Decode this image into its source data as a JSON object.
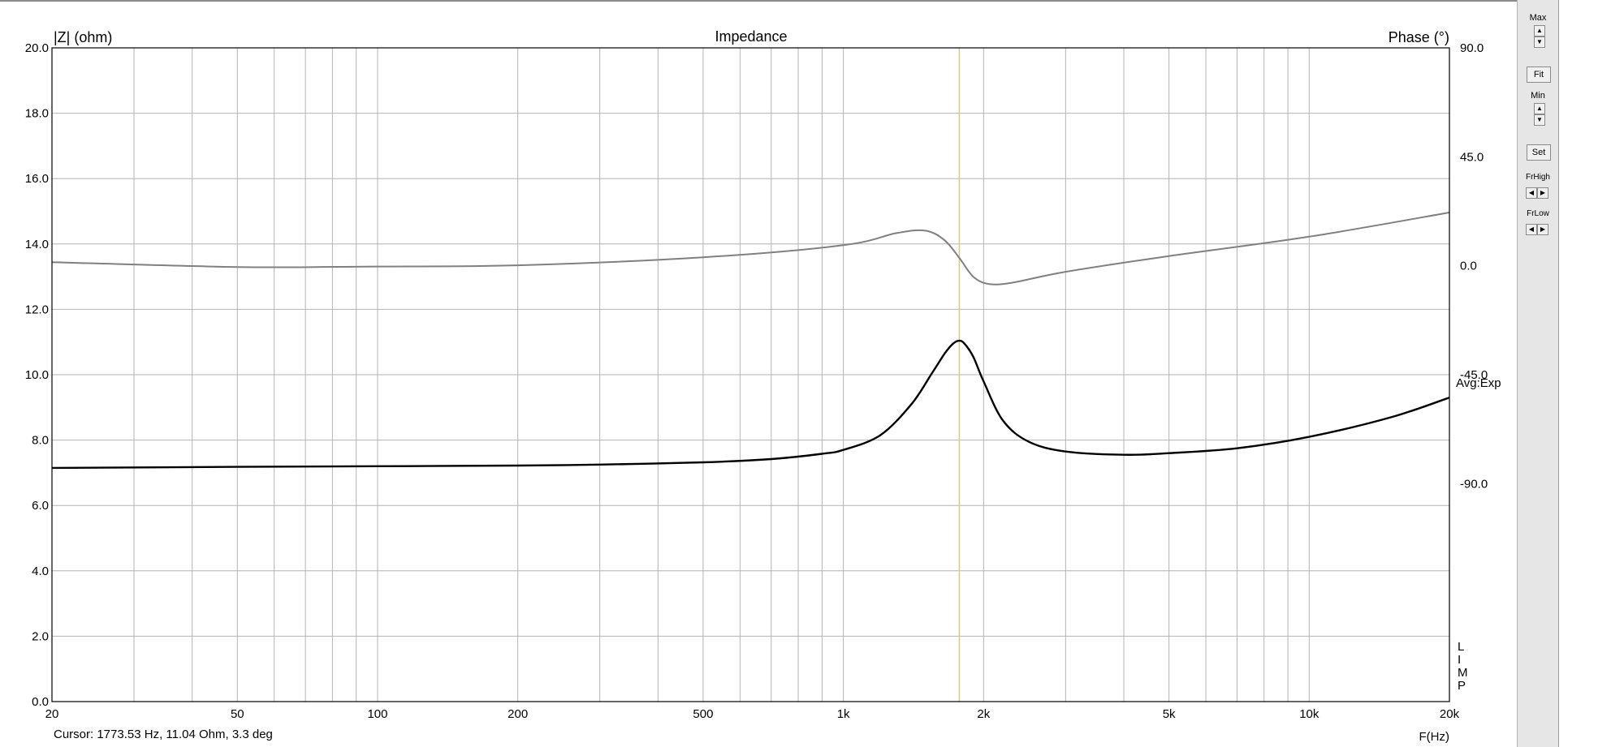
{
  "chart_data": {
    "type": "line",
    "title": "Impedance",
    "ylabel": "|Z| (ohm)",
    "y2label": "Phase (°)",
    "xlabel": "F(Hz)",
    "x_scale": "log",
    "xlim": [
      20,
      20000
    ],
    "ylim": [
      0,
      20
    ],
    "y2lim": [
      -180,
      90
    ],
    "x_ticks": [
      20,
      50,
      100,
      200,
      500,
      1000,
      2000,
      5000,
      10000,
      20000
    ],
    "x_tick_labels": [
      "20",
      "50",
      "100",
      "200",
      "500",
      "1k",
      "2k",
      "5k",
      "10k",
      "20k"
    ],
    "y_tick_labels": [
      "0.0",
      "2.0",
      "4.0",
      "6.0",
      "8.0",
      "10.0",
      "12.0",
      "14.0",
      "16.0",
      "18.0",
      "20.0"
    ],
    "y2_tick_labels": [
      "90.0",
      "45.0",
      "0.0",
      "-45.0",
      "-90.0"
    ],
    "grid": true,
    "cursor_freq": 1773.53,
    "series": [
      {
        "role": "magnitude",
        "color": "#000000",
        "x": [
          20,
          50,
          100,
          200,
          300,
          500,
          700,
          900,
          1000,
          1200,
          1400,
          1550,
          1650,
          1720,
          1773,
          1820,
          1900,
          2000,
          2200,
          2500,
          3000,
          4000,
          5000,
          7000,
          10000,
          15000,
          20000
        ],
        "y": [
          7.15,
          7.18,
          7.2,
          7.22,
          7.25,
          7.32,
          7.42,
          7.58,
          7.7,
          8.15,
          9.1,
          10.05,
          10.65,
          10.95,
          11.04,
          10.95,
          10.55,
          9.8,
          8.6,
          7.95,
          7.65,
          7.55,
          7.6,
          7.75,
          8.1,
          8.7,
          9.3
        ]
      },
      {
        "role": "phase",
        "color": "#808080",
        "x": [
          20,
          50,
          100,
          200,
          500,
          1000,
          1300,
          1500,
          1650,
          1773,
          1900,
          2050,
          2300,
          3000,
          5000,
          10000,
          20000
        ],
        "y": [
          1.5,
          -0.5,
          -0.3,
          0.2,
          3.5,
          8.5,
          13.5,
          14.5,
          10.5,
          3.3,
          -4.5,
          -7.5,
          -7,
          -2.5,
          4,
          12,
          22
        ]
      }
    ],
    "legend_text": "Avg:Exp",
    "side_letters": [
      "L",
      "I",
      "M",
      "P"
    ]
  },
  "status": {
    "cursor_readout": "Cursor: 1773.53 Hz, 11.04 Ohm, 3.3 deg"
  },
  "panel": {
    "max_label": "Max",
    "fit_label": "Fit",
    "min_label": "Min",
    "set_label": "Set",
    "frhigh_label": "FrHigh",
    "frlow_label": "FrLow"
  },
  "colors": {
    "grid": "#b4b4b4",
    "cursor_line": "#d4d45a",
    "panel_bg": "#e6e6e6"
  }
}
